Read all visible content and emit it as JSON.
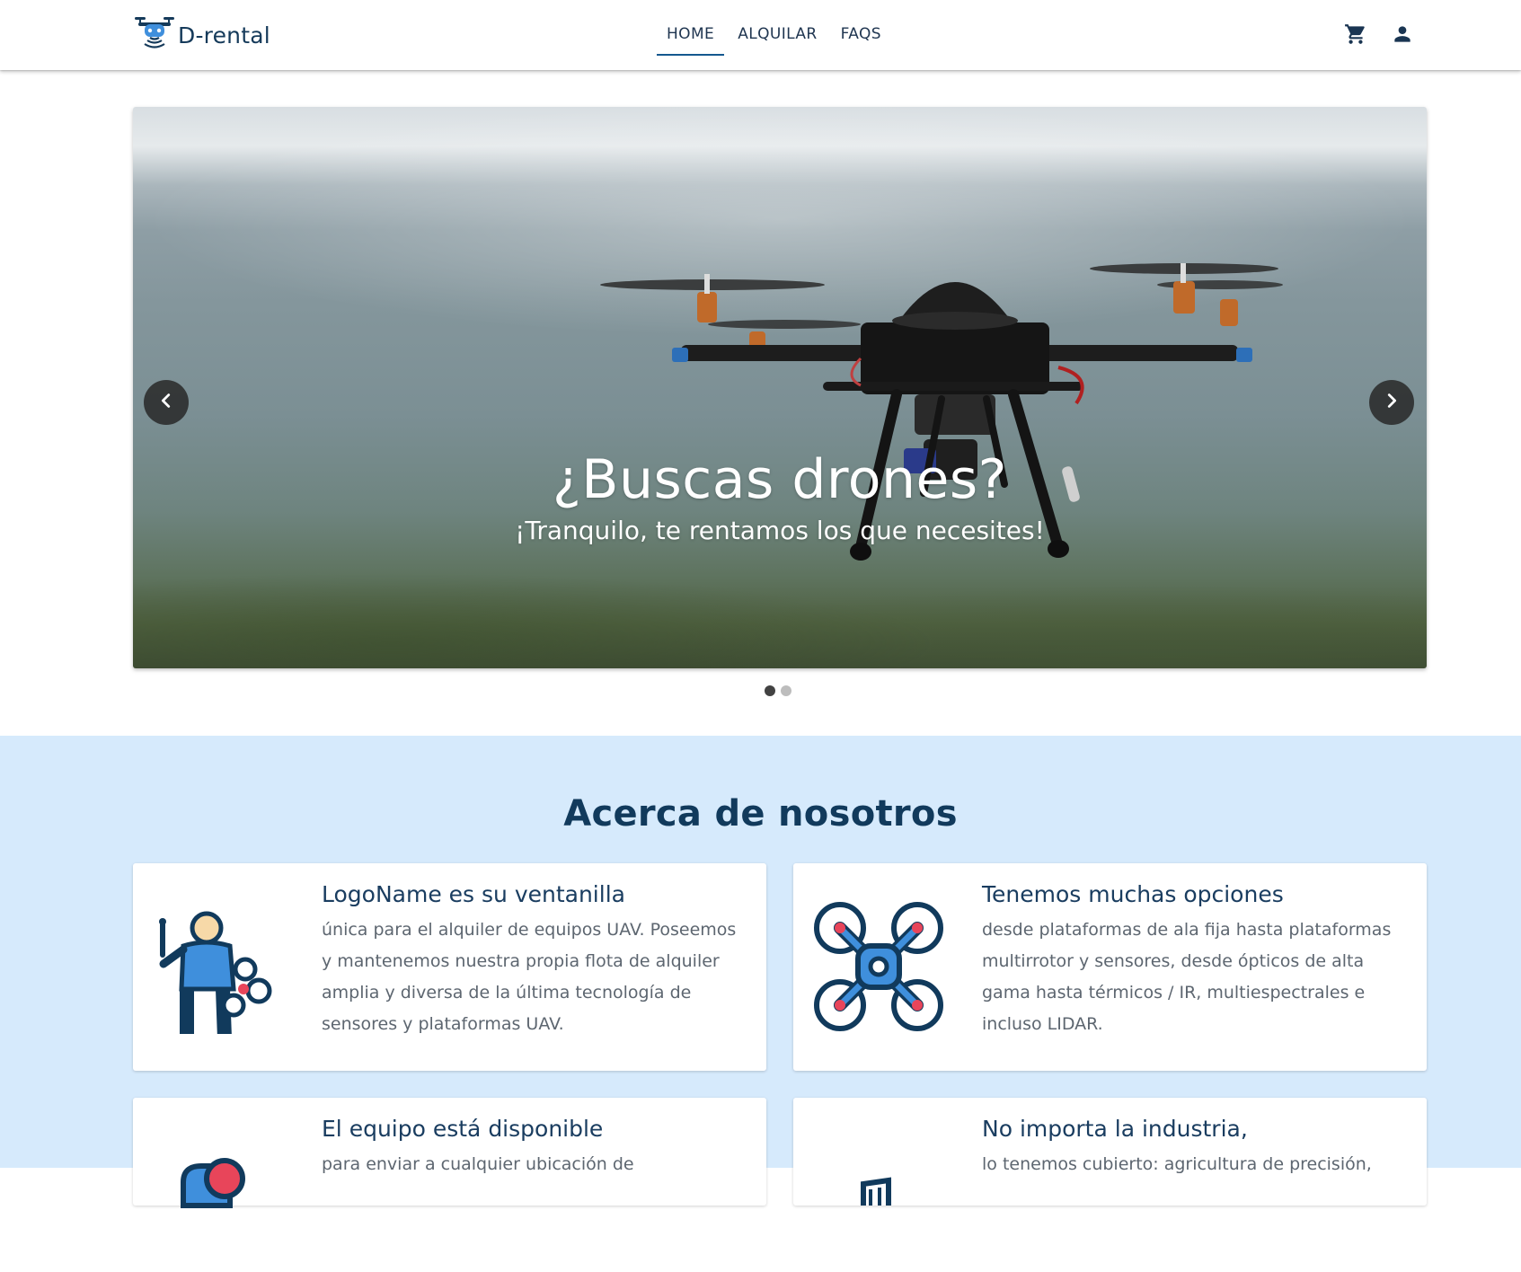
{
  "header": {
    "brand_name": "D-rental",
    "brand_icon": "drone-logo-icon",
    "nav": [
      {
        "label": "HOME",
        "active": true
      },
      {
        "label": "ALQUILAR",
        "active": false
      },
      {
        "label": "FAQS",
        "active": false
      }
    ],
    "icons": [
      "cart-icon",
      "user-icon"
    ]
  },
  "hero": {
    "title": "¿Buscas drones?",
    "subtitle": "¡Tranquilo, te rentamos los que necesites!",
    "slide_count": 2,
    "active_slide": 1
  },
  "about": {
    "title": "Acerca de nosotros",
    "cards": [
      {
        "title": "LogoName es su ventanilla",
        "text": "única para el alquiler de equipos UAV. Poseemos y mantenemos nuestra propia flota de alquiler amplia y diversa de la última tecnología de sensores y plataformas UAV.",
        "icon": "drone-pilot-icon"
      },
      {
        "title": "Tenemos muchas opciones",
        "text": "desde plataformas de ala fija hasta plataformas multirrotor y sensores, desde ópticos de alta gama hasta térmicos / IR, multiespectrales e incluso LIDAR.",
        "icon": "quadcopter-icon"
      },
      {
        "title": "El equipo está disponible",
        "text": "para enviar a cualquier ubicación de",
        "icon": "shipping-icon"
      },
      {
        "title": "No importa la industria,",
        "text": "lo tenemos cubierto: agricultura de precisión,",
        "icon": "industry-icon"
      }
    ]
  },
  "colors": {
    "brand_dark": "#153a5a",
    "about_bg": "#d6eafc",
    "accent_blue": "#3f8fdc",
    "accent_red": "#e8455a"
  }
}
